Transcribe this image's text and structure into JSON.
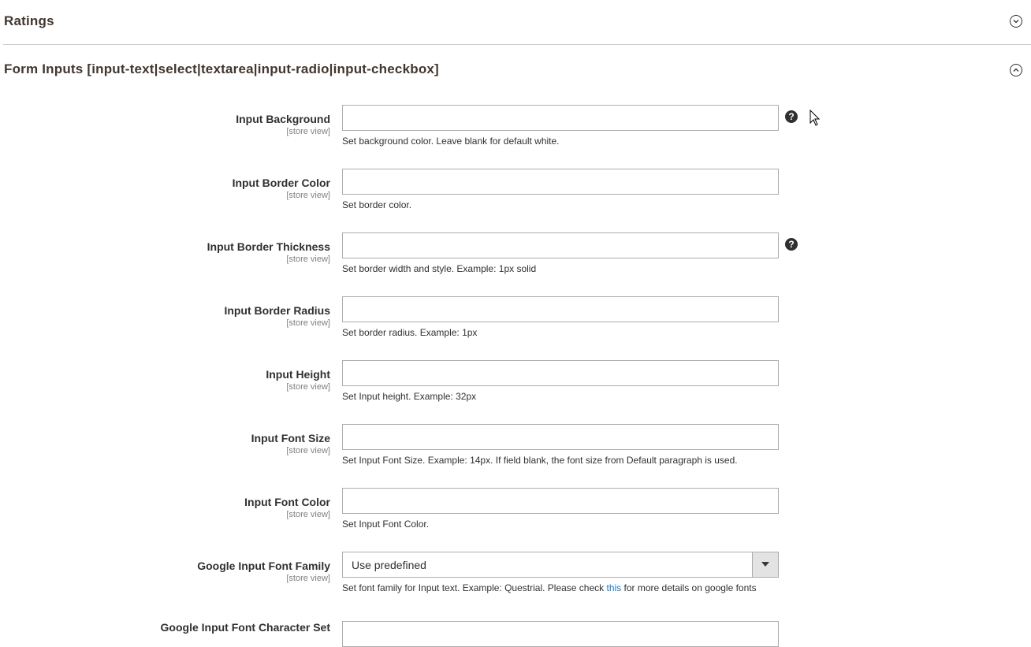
{
  "sections": {
    "ratings": {
      "title": "Ratings",
      "state": "collapsed"
    },
    "form_inputs": {
      "title": "Form Inputs [input-text|select|textarea|input-radio|input-checkbox]",
      "state": "expanded"
    }
  },
  "fields": [
    {
      "label": "Input Background",
      "scope": "[store view]",
      "value": "",
      "note": "Set background color. Leave blank for default white.",
      "help": "?"
    },
    {
      "label": "Input Border Color",
      "scope": "[store view]",
      "value": "",
      "note": "Set border color."
    },
    {
      "label": "Input Border Thickness",
      "scope": "[store view]",
      "value": "",
      "note": "Set border width and style. Example: 1px solid",
      "help": "?"
    },
    {
      "label": "Input Border Radius",
      "scope": "[store view]",
      "value": "",
      "note": "Set border radius. Example: 1px"
    },
    {
      "label": "Input Height",
      "scope": "[store view]",
      "value": "",
      "note": "Set Input height. Example: 32px"
    },
    {
      "label": "Input Font Size",
      "scope": "[store view]",
      "value": "",
      "note": "Set Input Font Size. Example: 14px. If field blank, the font size from Default paragraph is used."
    },
    {
      "label": "Input Font Color",
      "scope": "[store view]",
      "value": "",
      "note": "Set Input Font Color."
    }
  ],
  "font_family": {
    "label": "Google Input Font Family",
    "scope": "[store view]",
    "selected": "Use predefined",
    "note_before": "Set font family for Input text. Example: Questrial. Please check ",
    "note_link": "this",
    "note_after": " for more details on google fonts"
  },
  "char_set": {
    "label": "Google Input Font Character Set"
  },
  "colors": {
    "link": "#1979c3",
    "text": "#303030",
    "scope": "#808080",
    "border": "#adadad"
  }
}
